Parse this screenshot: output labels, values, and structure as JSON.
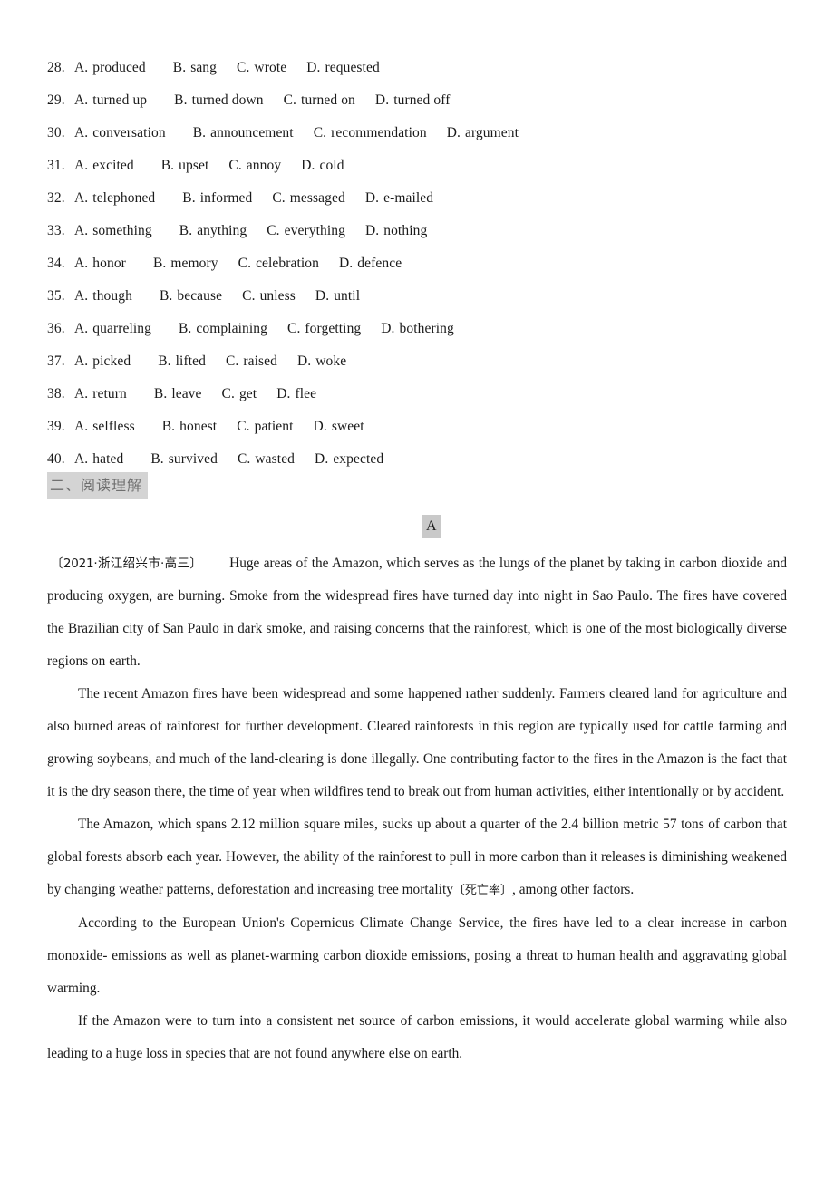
{
  "document": {
    "questions": [
      {
        "num": "28.",
        "options": [
          {
            "label": "A.",
            "text": "produced"
          },
          {
            "label": "B.",
            "text": "sang"
          },
          {
            "label": "C.",
            "text": "wrote"
          },
          {
            "label": "D.",
            "text": "requested"
          }
        ]
      },
      {
        "num": "29.",
        "options": [
          {
            "label": "A.",
            "text": "turned up"
          },
          {
            "label": "B.",
            "text": "turned down"
          },
          {
            "label": "C.",
            "text": "turned on"
          },
          {
            "label": "D.",
            "text": "turned off"
          }
        ]
      },
      {
        "num": "30.",
        "options": [
          {
            "label": "A.",
            "text": "conversation"
          },
          {
            "label": "B.",
            "text": "announcement"
          },
          {
            "label": "C.",
            "text": "recommendation"
          },
          {
            "label": "D.",
            "text": "argument"
          }
        ]
      },
      {
        "num": "31.",
        "options": [
          {
            "label": "A.",
            "text": "excited"
          },
          {
            "label": "B.",
            "text": "upset"
          },
          {
            "label": "C.",
            "text": "annoy"
          },
          {
            "label": "D.",
            "text": "cold"
          }
        ]
      },
      {
        "num": "32.",
        "options": [
          {
            "label": "A.",
            "text": "telephoned"
          },
          {
            "label": "B.",
            "text": "informed"
          },
          {
            "label": "C.",
            "text": "messaged"
          },
          {
            "label": "D.",
            "text": "e-mailed"
          }
        ]
      },
      {
        "num": "33.",
        "options": [
          {
            "label": "A.",
            "text": "something"
          },
          {
            "label": "B.",
            "text": "anything"
          },
          {
            "label": "C.",
            "text": "everything"
          },
          {
            "label": "D.",
            "text": "nothing"
          }
        ]
      },
      {
        "num": "34.",
        "options": [
          {
            "label": "A.",
            "text": "honor"
          },
          {
            "label": "B.",
            "text": "memory"
          },
          {
            "label": "C.",
            "text": "celebration"
          },
          {
            "label": "D.",
            "text": "defence"
          }
        ]
      },
      {
        "num": "35.",
        "options": [
          {
            "label": "A.",
            "text": "though"
          },
          {
            "label": "B.",
            "text": "because"
          },
          {
            "label": "C.",
            "text": "unless"
          },
          {
            "label": "D.",
            "text": "until"
          }
        ]
      },
      {
        "num": "36.",
        "options": [
          {
            "label": "A.",
            "text": "quarreling"
          },
          {
            "label": "B.",
            "text": "complaining"
          },
          {
            "label": "C.",
            "text": "forgetting"
          },
          {
            "label": "D.",
            "text": "bothering"
          }
        ]
      },
      {
        "num": "37.",
        "options": [
          {
            "label": "A.",
            "text": "picked"
          },
          {
            "label": "B.",
            "text": "lifted"
          },
          {
            "label": "C.",
            "text": "raised"
          },
          {
            "label": "D.",
            "text": "woke"
          }
        ]
      },
      {
        "num": "38.",
        "options": [
          {
            "label": "A.",
            "text": "return"
          },
          {
            "label": "B.",
            "text": "leave"
          },
          {
            "label": "C.",
            "text": "get"
          },
          {
            "label": "D.",
            "text": "flee"
          }
        ]
      },
      {
        "num": "39.",
        "options": [
          {
            "label": "A.",
            "text": "selfless"
          },
          {
            "label": "B.",
            "text": "honest"
          },
          {
            "label": "C.",
            "text": "patient"
          },
          {
            "label": "D.",
            "text": "sweet"
          }
        ]
      },
      {
        "num": "40.",
        "options": [
          {
            "label": "A.",
            "text": "hated"
          },
          {
            "label": "B.",
            "text": "survived"
          },
          {
            "label": "C.",
            "text": "wasted"
          },
          {
            "label": "D.",
            "text": "expected"
          }
        ]
      }
    ],
    "section_heading": "二、阅读理解",
    "passage_label": "A",
    "source_tag": "〔2021·浙江绍兴市·高三〕",
    "paragraphs": {
      "p1_after_source": "Huge areas of the Amazon, which serves as the lungs of the planet by taking in carbon dioxide and producing oxygen, are burning. Smoke from the widespread fires have turned day into night in Sao Paulo. The fires have covered the Brazilian city of San Paulo in dark smoke, and raising concerns that the rainforest, which is one of the most biologically diverse regions on earth.",
      "p2": "The recent Amazon fires have been widespread and some happened rather suddenly. Farmers cleared land for agriculture and also burned areas of rainforest for further development. Cleared rainforests in this region are typically used for cattle farming and growing soybeans, and much of the land-clearing is done illegally. One contributing factor to the fires in the Amazon is the fact that it is the dry season there, the time of year when wildfires tend to break out from human activities, either intentionally or by accident.",
      "p3_before_gloss": "The Amazon, which spans 2.12 million square miles, sucks up about a quarter of the 2.4 billion metric 57 tons of carbon that global forests absorb each year. However, the ability of the rainforest to pull in more carbon than it releases is diminishing weakened by changing weather patterns, deforestation and increasing tree mortality",
      "p3_gloss": "〔死亡率〕",
      "p3_after_gloss": ", among other factors.",
      "p4": "According to the European Union's Copernicus Climate Change Service, the fires have led to a clear increase in carbon monoxide- emissions as well as planet-warming carbon dioxide emissions, posing a threat to human health and aggravating global warming.",
      "p5": "If the Amazon were to turn into a consistent net source of carbon emissions, it would accelerate global warming while also leading to a huge loss in species that are not found anywhere else on earth."
    },
    "colors": {
      "highlight_gray": "#d4d4d4",
      "label_gray": "#c9c9c9",
      "heading_text": "#6f6f6f",
      "body_text": "#1a1a1a",
      "page_background": "#ffffff"
    }
  }
}
